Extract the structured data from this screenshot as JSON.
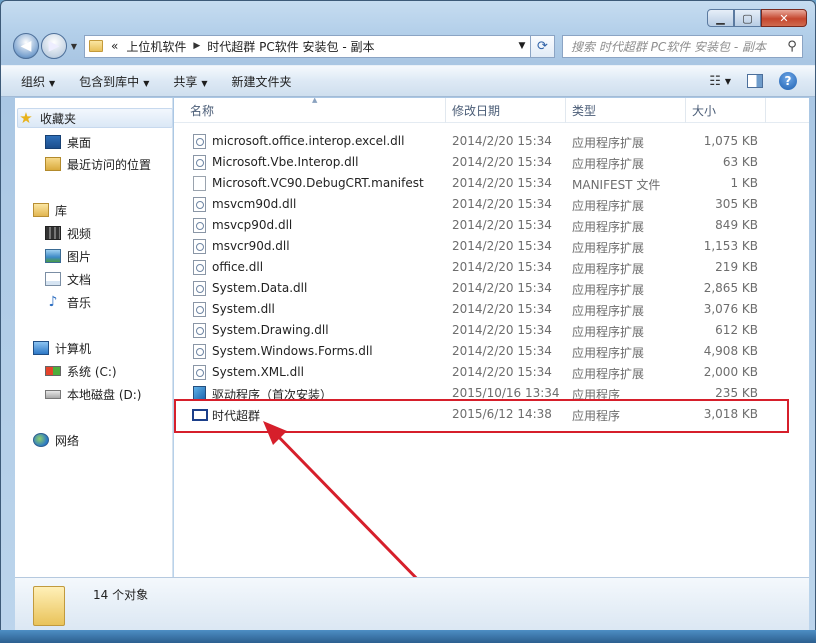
{
  "window": {
    "caption_buttons": [
      "minimize",
      "maximize",
      "close"
    ]
  },
  "address": {
    "prefix": "«",
    "crumbs": [
      "上位机软件",
      "时代超群 PC软件 安装包 - 副本"
    ]
  },
  "search": {
    "placeholder": "搜索 时代超群 PC软件 安装包 - 副本"
  },
  "toolbar": {
    "organize": "组织",
    "include_in_library": "包含到库中",
    "share": "共享",
    "new_folder": "新建文件夹"
  },
  "nav": {
    "favorites": "收藏夹",
    "desktop": "桌面",
    "recent": "最近访问的位置",
    "libraries": "库",
    "videos": "视频",
    "pictures": "图片",
    "documents": "文档",
    "music": "音乐",
    "computer": "计算机",
    "system_drive": "系统 (C:)",
    "local_disk": "本地磁盘 (D:)",
    "network": "网络"
  },
  "columns": {
    "name": "名称",
    "modified": "修改日期",
    "type": "类型",
    "size": "大小"
  },
  "files": [
    {
      "name": "microsoft.office.interop.excel.dll",
      "date": "2014/2/20 15:34",
      "type": "应用程序扩展",
      "size": "1,075 KB"
    },
    {
      "name": "Microsoft.Vbe.Interop.dll",
      "date": "2014/2/20 15:34",
      "type": "应用程序扩展",
      "size": "63 KB"
    },
    {
      "name": "Microsoft.VC90.DebugCRT.manifest",
      "date": "2014/2/20 15:34",
      "type": "MANIFEST 文件",
      "size": "1 KB"
    },
    {
      "name": "msvcm90d.dll",
      "date": "2014/2/20 15:34",
      "type": "应用程序扩展",
      "size": "305 KB"
    },
    {
      "name": "msvcp90d.dll",
      "date": "2014/2/20 15:34",
      "type": "应用程序扩展",
      "size": "849 KB"
    },
    {
      "name": "msvcr90d.dll",
      "date": "2014/2/20 15:34",
      "type": "应用程序扩展",
      "size": "1,153 KB"
    },
    {
      "name": "office.dll",
      "date": "2014/2/20 15:34",
      "type": "应用程序扩展",
      "size": "219 KB"
    },
    {
      "name": "System.Data.dll",
      "date": "2014/2/20 15:34",
      "type": "应用程序扩展",
      "size": "2,865 KB"
    },
    {
      "name": "System.dll",
      "date": "2014/2/20 15:34",
      "type": "应用程序扩展",
      "size": "3,076 KB"
    },
    {
      "name": "System.Drawing.dll",
      "date": "2014/2/20 15:34",
      "type": "应用程序扩展",
      "size": "612 KB"
    },
    {
      "name": "System.Windows.Forms.dll",
      "date": "2014/2/20 15:34",
      "type": "应用程序扩展",
      "size": "4,908 KB"
    },
    {
      "name": "System.XML.dll",
      "date": "2014/2/20 15:34",
      "type": "应用程序扩展",
      "size": "2,000 KB"
    },
    {
      "name": "驱动程序（首次安装）",
      "date": "2015/10/16 13:34",
      "type": "应用程序",
      "size": "235 KB"
    },
    {
      "name": "时代超群",
      "date": "2015/6/12 14:38",
      "type": "应用程序",
      "size": "3,018 KB"
    }
  ],
  "status": {
    "count": "14 个对象"
  },
  "colors": {
    "highlight": "#d61f2b",
    "arrow": "#d61f2b"
  }
}
